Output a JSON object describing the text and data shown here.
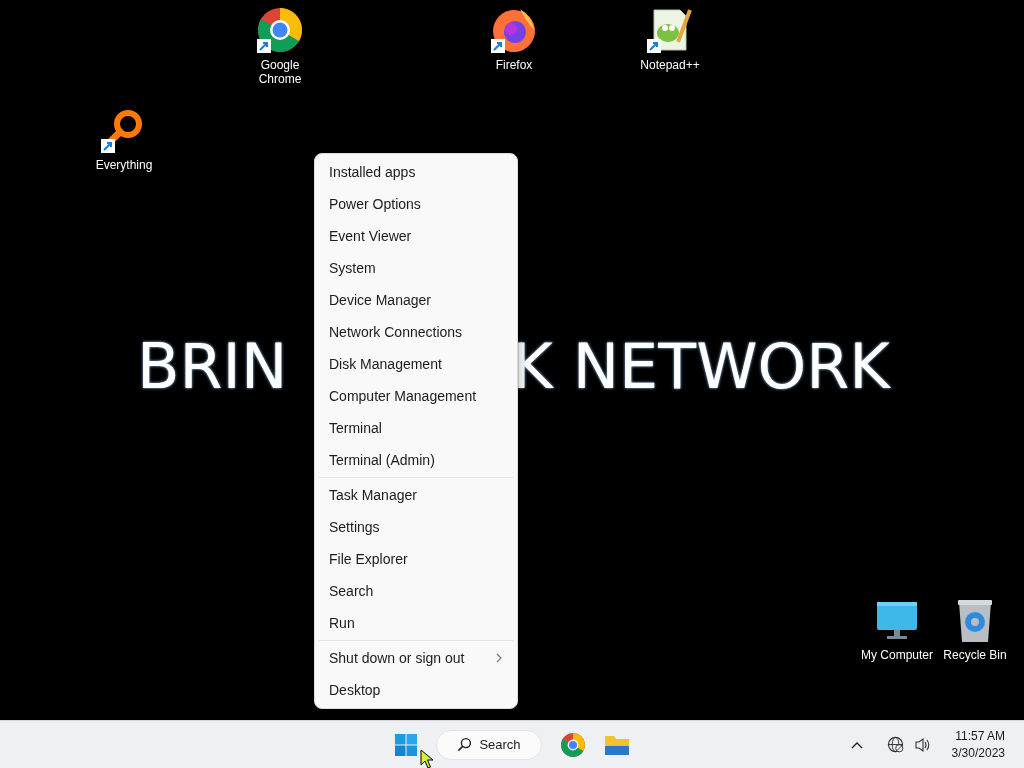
{
  "wallpaper": {
    "texts": [
      "BRIN",
      "K NETWORK"
    ]
  },
  "desktop_icons": [
    {
      "kind": "chrome",
      "label": "Google Chrome",
      "shortcut": true
    },
    {
      "kind": "firefox",
      "label": "Firefox",
      "shortcut": true
    },
    {
      "kind": "notepadpp",
      "label": "Notepad++",
      "shortcut": true
    },
    {
      "kind": "everything",
      "label": "Everything",
      "shortcut": true
    },
    {
      "kind": "computer",
      "label": "My Computer",
      "shortcut": false
    },
    {
      "kind": "recycle",
      "label": "Recycle Bin",
      "shortcut": false
    }
  ],
  "context_menu": {
    "groups": [
      {
        "items": [
          {
            "label": "Installed apps",
            "submenu": false
          },
          {
            "label": "Power Options",
            "submenu": false
          },
          {
            "label": "Event Viewer",
            "submenu": false
          },
          {
            "label": "System",
            "submenu": false
          },
          {
            "label": "Device Manager",
            "submenu": false
          },
          {
            "label": "Network Connections",
            "submenu": false
          },
          {
            "label": "Disk Management",
            "submenu": false
          },
          {
            "label": "Computer Management",
            "submenu": false
          },
          {
            "label": "Terminal",
            "submenu": false
          },
          {
            "label": "Terminal (Admin)",
            "submenu": false
          }
        ]
      },
      {
        "items": [
          {
            "label": "Task Manager",
            "submenu": false
          },
          {
            "label": "Settings",
            "submenu": false
          },
          {
            "label": "File Explorer",
            "submenu": false
          },
          {
            "label": "Search",
            "submenu": false
          },
          {
            "label": "Run",
            "submenu": false
          }
        ]
      },
      {
        "items": [
          {
            "label": "Shut down or sign out",
            "submenu": true
          },
          {
            "label": "Desktop",
            "submenu": false
          }
        ]
      }
    ]
  },
  "taskbar": {
    "items": [
      {
        "kind": "start"
      },
      {
        "kind": "search",
        "label": "Search"
      },
      {
        "kind": "chrome"
      },
      {
        "kind": "explorer"
      }
    ],
    "tray": {
      "time": "11:57 AM",
      "date": "3/30/2023"
    }
  }
}
